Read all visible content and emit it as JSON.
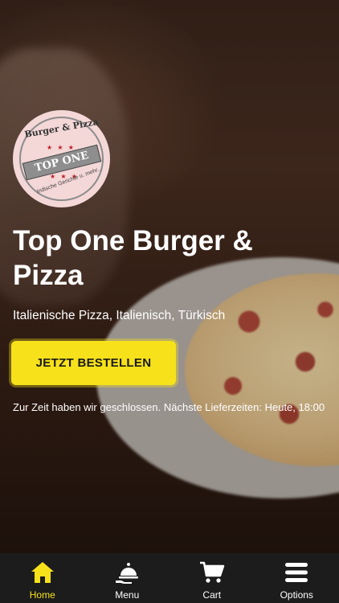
{
  "restaurant": {
    "name": "Top One Burger & Pizza",
    "cuisines": "Italienische Pizza, Italienisch, Türkisch",
    "order_button_label": "JETZT BESTELLEN",
    "closed_notice": "Zur Zeit haben wir geschlossen. Nächste Lieferzeiten: Heute, 18:00"
  },
  "logo": {
    "top_text": "Burger & Pizza",
    "banner_text": "TOP ONE",
    "bottom_text": "Indische Gerichte u. mehr...",
    "stars": "★ ★ ★"
  },
  "tabbar": {
    "items": [
      {
        "label": "Home",
        "icon": "home-icon",
        "active": true
      },
      {
        "label": "Menu",
        "icon": "cloche-icon",
        "active": false
      },
      {
        "label": "Cart",
        "icon": "cart-icon",
        "active": false
      },
      {
        "label": "Options",
        "icon": "menu-icon",
        "active": false
      }
    ]
  },
  "colors": {
    "accent": "#f7e11b",
    "tabbar_bg": "#1c1c1c",
    "text": "#ffffff"
  }
}
